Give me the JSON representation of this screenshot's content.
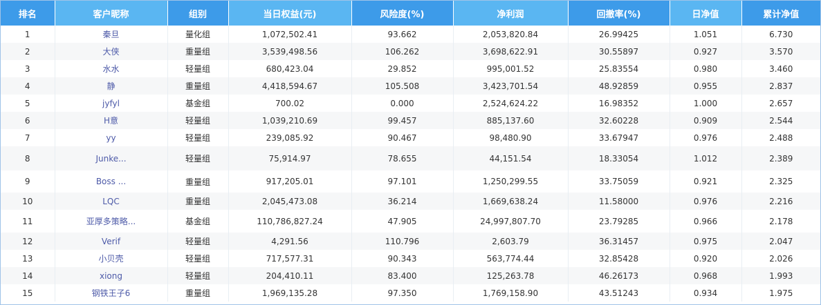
{
  "columns": [
    "排名",
    "客户昵称",
    "组别",
    "当日权益(元)",
    "风险度(%)",
    "净利润",
    "回撤率(%)",
    "日净值",
    "累计净值"
  ],
  "rows": [
    {
      "rank": "1",
      "name": "秦旦",
      "group": "量化组",
      "equity": "1,072,502.41",
      "risk": "93.662",
      "profit": "2,053,820.84",
      "drawdown": "26.99425",
      "daily_nav": "1.051",
      "cum_nav": "6.730"
    },
    {
      "rank": "2",
      "name": "大侠",
      "group": "重量组",
      "equity": "3,539,498.56",
      "risk": "106.262",
      "profit": "3,698,622.91",
      "drawdown": "30.55897",
      "daily_nav": "0.927",
      "cum_nav": "3.570"
    },
    {
      "rank": "3",
      "name": "水水",
      "group": "轻量组",
      "equity": "680,423.04",
      "risk": "29.852",
      "profit": "995,001.52",
      "drawdown": "25.83554",
      "daily_nav": "0.980",
      "cum_nav": "3.460"
    },
    {
      "rank": "4",
      "name": "静",
      "group": "重量组",
      "equity": "4,418,594.67",
      "risk": "105.508",
      "profit": "3,423,701.54",
      "drawdown": "48.92859",
      "daily_nav": "0.955",
      "cum_nav": "2.837"
    },
    {
      "rank": "5",
      "name": "jyfyl",
      "group": "基金组",
      "equity": "700.02",
      "risk": "0.000",
      "profit": "2,524,624.22",
      "drawdown": "16.98352",
      "daily_nav": "1.000",
      "cum_nav": "2.657"
    },
    {
      "rank": "6",
      "name": "H意",
      "group": "轻量组",
      "equity": "1,039,210.69",
      "risk": "99.457",
      "profit": "885,137.60",
      "drawdown": "32.60228",
      "daily_nav": "0.909",
      "cum_nav": "2.544"
    },
    {
      "rank": "7",
      "name": "yy",
      "group": "轻量组",
      "equity": "239,085.92",
      "risk": "90.467",
      "profit": "98,480.90",
      "drawdown": "33.67947",
      "daily_nav": "0.976",
      "cum_nav": "2.488"
    },
    {
      "rank": "8",
      "name": "Junke...",
      "group": "轻量组",
      "equity": "75,914.97",
      "risk": "78.655",
      "profit": "44,151.54",
      "drawdown": "18.33054",
      "daily_nav": "1.012",
      "cum_nav": "2.389"
    },
    {
      "rank": "9",
      "name": "Boss ...",
      "group": "重量组",
      "equity": "917,205.01",
      "risk": "97.101",
      "profit": "1,250,299.55",
      "drawdown": "33.75059",
      "daily_nav": "0.921",
      "cum_nav": "2.325"
    },
    {
      "rank": "10",
      "name": "LQC",
      "group": "重量组",
      "equity": "2,045,473.08",
      "risk": "36.214",
      "profit": "1,669,638.24",
      "drawdown": "11.58000",
      "daily_nav": "0.976",
      "cum_nav": "2.216"
    },
    {
      "rank": "11",
      "name": "亚厚多策略...",
      "group": "基金组",
      "equity": "110,786,827.24",
      "risk": "47.905",
      "profit": "24,997,807.70",
      "drawdown": "23.79285",
      "daily_nav": "0.966",
      "cum_nav": "2.178"
    },
    {
      "rank": "12",
      "name": "Verif",
      "group": "轻量组",
      "equity": "4,291.56",
      "risk": "110.796",
      "profit": "2,603.79",
      "drawdown": "36.31457",
      "daily_nav": "0.975",
      "cum_nav": "2.047"
    },
    {
      "rank": "13",
      "name": "小贝壳",
      "group": "轻量组",
      "equity": "717,577.31",
      "risk": "90.343",
      "profit": "563,774.44",
      "drawdown": "32.85428",
      "daily_nav": "0.920",
      "cum_nav": "2.026"
    },
    {
      "rank": "14",
      "name": "xiong",
      "group": "轻量组",
      "equity": "204,410.11",
      "risk": "83.400",
      "profit": "125,263.78",
      "drawdown": "46.26173",
      "daily_nav": "0.968",
      "cum_nav": "1.993"
    },
    {
      "rank": "15",
      "name": "钢铁王子6",
      "group": "重量组",
      "equity": "1,969,135.28",
      "risk": "97.350",
      "profit": "1,769,158.90",
      "drawdown": "43.51243",
      "daily_nav": "0.934",
      "cum_nav": "1.975"
    }
  ],
  "colors": {
    "header_dark": "#3d9be9",
    "header_light": "#5ab6f2",
    "row_alt": "#f6f7f8",
    "name_text": "#4d5aa8",
    "border": "#9fc3e8"
  }
}
